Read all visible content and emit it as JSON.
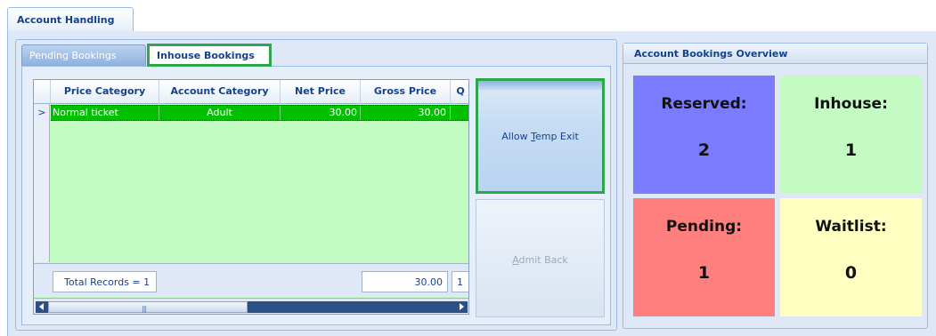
{
  "top_tab": {
    "label": "Account Handling"
  },
  "tabs": {
    "pending": "Pending Bookings",
    "inhouse": "Inhouse Bookings"
  },
  "grid": {
    "columns": [
      "Price Category",
      "Account Category",
      "Net Price",
      "Gross Price",
      "Q"
    ],
    "rows": [
      {
        "indicator": ">",
        "price_category": "Normal ticket",
        "account_category": "Adult",
        "net_price": "30.00",
        "gross_price": "30.00",
        "q": ""
      }
    ],
    "footer": {
      "total_records": "Total Records = 1",
      "gross_total": "30.00",
      "q_total": "1"
    },
    "scroll_grip": "|||"
  },
  "buttons": {
    "allow_temp_exit": {
      "before": "Allow ",
      "underline": "T",
      "after": "emp Exit"
    },
    "admit_back": {
      "before": "",
      "underline": "A",
      "after": "dmit Back"
    }
  },
  "overview": {
    "title": "Account Bookings Overview",
    "tiles": [
      {
        "label": "Reserved:",
        "value": "2",
        "color": "#7b7bff"
      },
      {
        "label": "Inhouse:",
        "value": "1",
        "color": "#c3fbc2"
      },
      {
        "label": "Pending:",
        "value": "1",
        "color": "#ff7e7e"
      },
      {
        "label": "Waitlist:",
        "value": "0",
        "color": "#ffffc2"
      }
    ]
  },
  "colors": {
    "selected_row": "#00c000",
    "grid_background": "#c2fbc2",
    "highlight_border": "#2ea54f"
  }
}
